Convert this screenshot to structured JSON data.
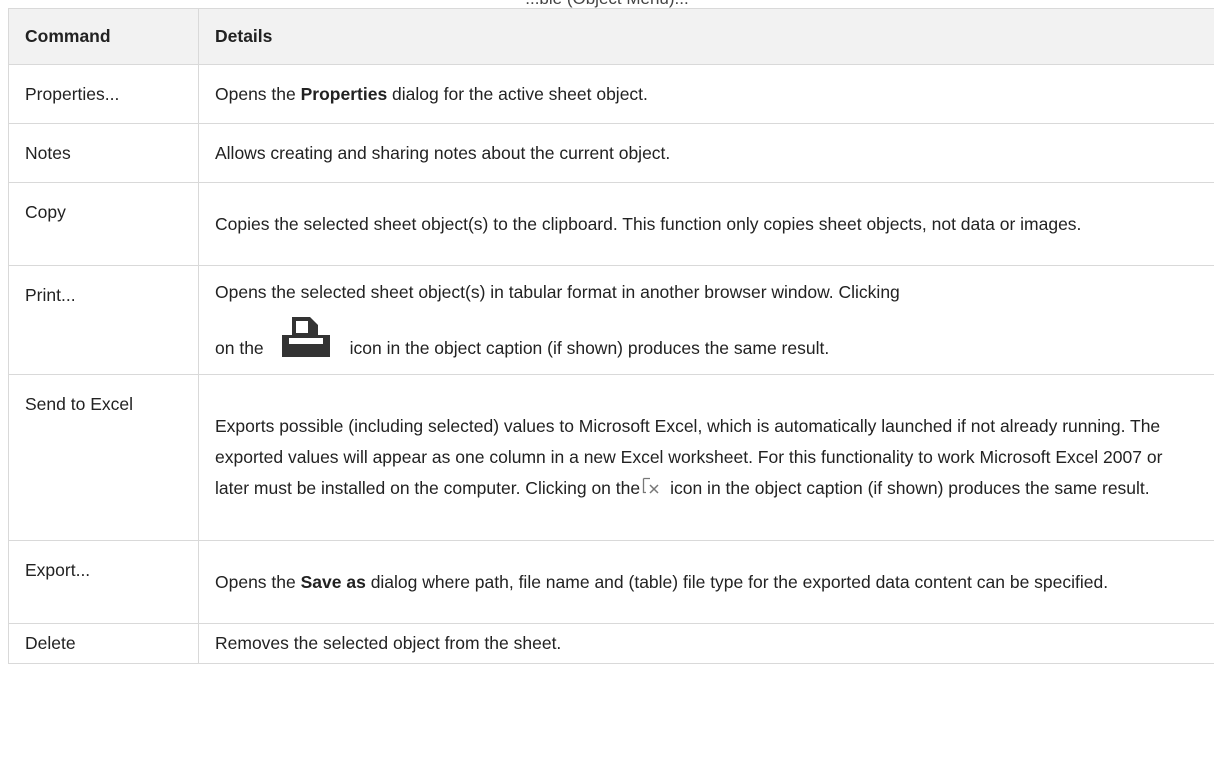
{
  "caption": "...ble (Object Menu)...",
  "table": {
    "headers": {
      "command": "Command",
      "details": "Details"
    },
    "rows": {
      "properties": {
        "command": "Properties...",
        "details_pre": "Opens the ",
        "details_bold": "Properties",
        "details_post": " dialog for the active sheet object."
      },
      "notes": {
        "command": "Notes",
        "details": "Allows creating and sharing notes about the current object."
      },
      "copy": {
        "command": "Copy",
        "details": "Copies the selected sheet object(s) to the clipboard. This function only copies sheet objects, not data or images."
      },
      "print": {
        "command": "Print...",
        "details_line1": "Opens the selected sheet object(s) in tabular format in another browser window. Clicking",
        "details_pre_icon": "on the",
        "icon": "printer-icon",
        "details_post_icon": "icon in the object caption (if shown) produces the same result."
      },
      "send_to_excel": {
        "command": "Send to Excel",
        "details_pre_icon": "Exports possible (including selected) values to Microsoft Excel, which is automatically launched if not already running. The exported values will appear as one column in a new Excel worksheet. For this functionality to work Microsoft Excel 2007 or later must be installed on the computer. Clicking on the",
        "icon": "excel-export-icon",
        "details_post_icon": "icon in the object caption (if shown) produces the same result."
      },
      "export": {
        "command": "Export...",
        "details_pre": "Opens the ",
        "details_bold": "Save as",
        "details_post": " dialog where path, file name and (table) file type for the exported data content can be specified."
      },
      "delete": {
        "command": "Delete",
        "details": "Removes the selected object from the sheet."
      }
    }
  },
  "colors": {
    "header_bg": "#f2f2f2",
    "border": "#d9d9d9",
    "text": "#222222",
    "icon_dark": "#333333"
  }
}
